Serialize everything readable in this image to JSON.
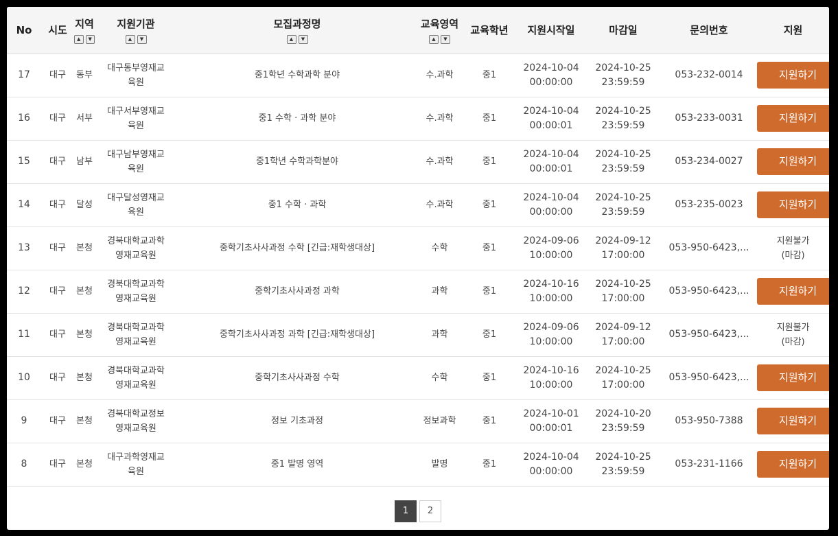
{
  "headers": {
    "no": "No",
    "sido": "시도",
    "region": "지역",
    "org": "지원기관",
    "course": "모집과정명",
    "area": "교육영역",
    "grade": "교육학년",
    "start": "지원시작일",
    "end": "마감일",
    "phone": "문의번호",
    "apply": "지원"
  },
  "sort_icons": {
    "up": "▲",
    "down": "▼"
  },
  "rows": [
    {
      "no": "17",
      "sido": "대구",
      "region": "동부",
      "org_1": "대구동부영재교",
      "org_2": "육원",
      "course": "중1학년 수학과학 분야",
      "area": "수.과학",
      "grade": "중1",
      "start_date": "2024-10-04",
      "start_time": "00:00:00",
      "end_date": "2024-10-25",
      "end_time": "23:59:59",
      "phone": "053-232-0014",
      "action": "지원하기"
    },
    {
      "no": "16",
      "sido": "대구",
      "region": "서부",
      "org_1": "대구서부영재교",
      "org_2": "육원",
      "course": "중1 수학 · 과학 분야",
      "area": "수.과학",
      "grade": "중1",
      "start_date": "2024-10-04",
      "start_time": "00:00:01",
      "end_date": "2024-10-25",
      "end_time": "23:59:59",
      "phone": "053-233-0031",
      "action": "지원하기"
    },
    {
      "no": "15",
      "sido": "대구",
      "region": "남부",
      "org_1": "대구남부영재교",
      "org_2": "육원",
      "course": "중1학년 수학과학분야",
      "area": "수.과학",
      "grade": "중1",
      "start_date": "2024-10-04",
      "start_time": "00:00:01",
      "end_date": "2024-10-25",
      "end_time": "23:59:59",
      "phone": "053-234-0027",
      "action": "지원하기"
    },
    {
      "no": "14",
      "sido": "대구",
      "region": "달성",
      "org_1": "대구달성영재교",
      "org_2": "육원",
      "course": "중1 수학 · 과학",
      "area": "수.과학",
      "grade": "중1",
      "start_date": "2024-10-04",
      "start_time": "00:00:00",
      "end_date": "2024-10-25",
      "end_time": "23:59:59",
      "phone": "053-235-0023",
      "action": "지원하기"
    },
    {
      "no": "13",
      "sido": "대구",
      "region": "본청",
      "org_1": "경북대학교과학",
      "org_2": "영재교육원",
      "course": "중학기초사사과정 수학 [긴급:재학생대상]",
      "area": "수학",
      "grade": "중1",
      "start_date": "2024-09-06",
      "start_time": "10:00:00",
      "end_date": "2024-09-12",
      "end_time": "17:00:00",
      "phone": "053-950-6423,...",
      "closed_1": "지원불가",
      "closed_2": "(마감)"
    },
    {
      "no": "12",
      "sido": "대구",
      "region": "본청",
      "org_1": "경북대학교과학",
      "org_2": "영재교육원",
      "course": "중학기초사사과정 과학",
      "area": "과학",
      "grade": "중1",
      "start_date": "2024-10-16",
      "start_time": "10:00:00",
      "end_date": "2024-10-25",
      "end_time": "17:00:00",
      "phone": "053-950-6423,...",
      "action": "지원하기"
    },
    {
      "no": "11",
      "sido": "대구",
      "region": "본청",
      "org_1": "경북대학교과학",
      "org_2": "영재교육원",
      "course": "중학기초사사과정 과학 [긴급:재학생대상]",
      "area": "과학",
      "grade": "중1",
      "start_date": "2024-09-06",
      "start_time": "10:00:00",
      "end_date": "2024-09-12",
      "end_time": "17:00:00",
      "phone": "053-950-6423,...",
      "closed_1": "지원불가",
      "closed_2": "(마감)"
    },
    {
      "no": "10",
      "sido": "대구",
      "region": "본청",
      "org_1": "경북대학교과학",
      "org_2": "영재교육원",
      "course": "중학기초사사과정 수학",
      "area": "수학",
      "grade": "중1",
      "start_date": "2024-10-16",
      "start_time": "10:00:00",
      "end_date": "2024-10-25",
      "end_time": "17:00:00",
      "phone": "053-950-6423,...",
      "action": "지원하기"
    },
    {
      "no": "9",
      "sido": "대구",
      "region": "본청",
      "org_1": "경북대학교정보",
      "org_2": "영재교육원",
      "course": "정보 기초과정",
      "area": "정보과학",
      "grade": "중1",
      "start_date": "2024-10-01",
      "start_time": "00:00:01",
      "end_date": "2024-10-20",
      "end_time": "23:59:59",
      "phone": "053-950-7388",
      "action": "지원하기"
    },
    {
      "no": "8",
      "sido": "대구",
      "region": "본청",
      "org_1": "대구과학영재교",
      "org_2": "육원",
      "course": "중1 발명 영역",
      "area": "발명",
      "grade": "중1",
      "start_date": "2024-10-04",
      "start_time": "00:00:00",
      "end_date": "2024-10-25",
      "end_time": "23:59:59",
      "phone": "053-231-1166",
      "action": "지원하기"
    }
  ],
  "pagination": {
    "pages": [
      "1",
      "2"
    ],
    "current": "1"
  },
  "colors": {
    "accent": "#cf6b2c",
    "page_active": "#444444"
  }
}
